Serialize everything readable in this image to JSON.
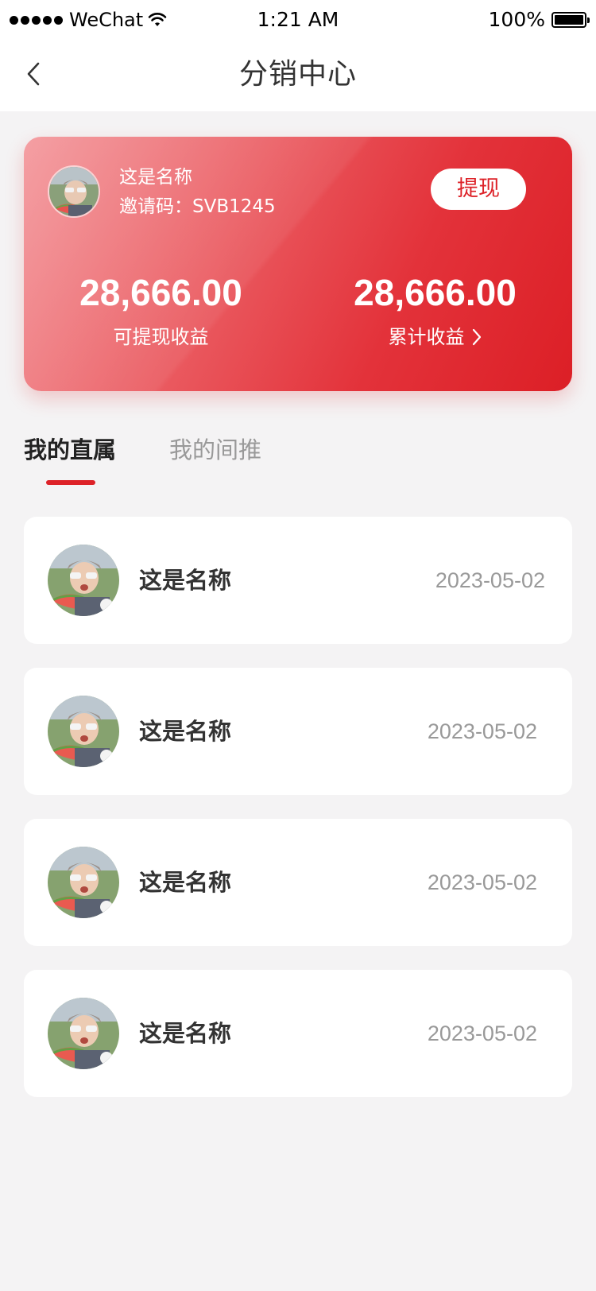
{
  "status_bar": {
    "carrier": "WeChat",
    "time": "1:21 AM",
    "battery": "100%"
  },
  "nav": {
    "title": "分销中心",
    "back_icon": "chevron-left-icon"
  },
  "card": {
    "user_name": "这是名称",
    "invite_code": "邀请码：SVB1245",
    "withdraw_label": "提现",
    "withdrawable_amount": "28,666.00",
    "withdrawable_label": "可提现收益",
    "total_amount": "28,666.00",
    "total_label": "累计收益",
    "gradient_colors": [
      "#f28a8f",
      "#dc1f26"
    ],
    "accent": "#dd2228"
  },
  "tabs": [
    {
      "label": "我的直属",
      "active": true
    },
    {
      "label": "我的间推",
      "active": false
    }
  ],
  "list": [
    {
      "name": "这是名称",
      "date": "2023-05-02"
    },
    {
      "name": "这是名称",
      "date": "2023-05-02"
    },
    {
      "name": "这是名称",
      "date": "2023-05-02"
    },
    {
      "name": "这是名称",
      "date": "2023-05-02"
    }
  ]
}
